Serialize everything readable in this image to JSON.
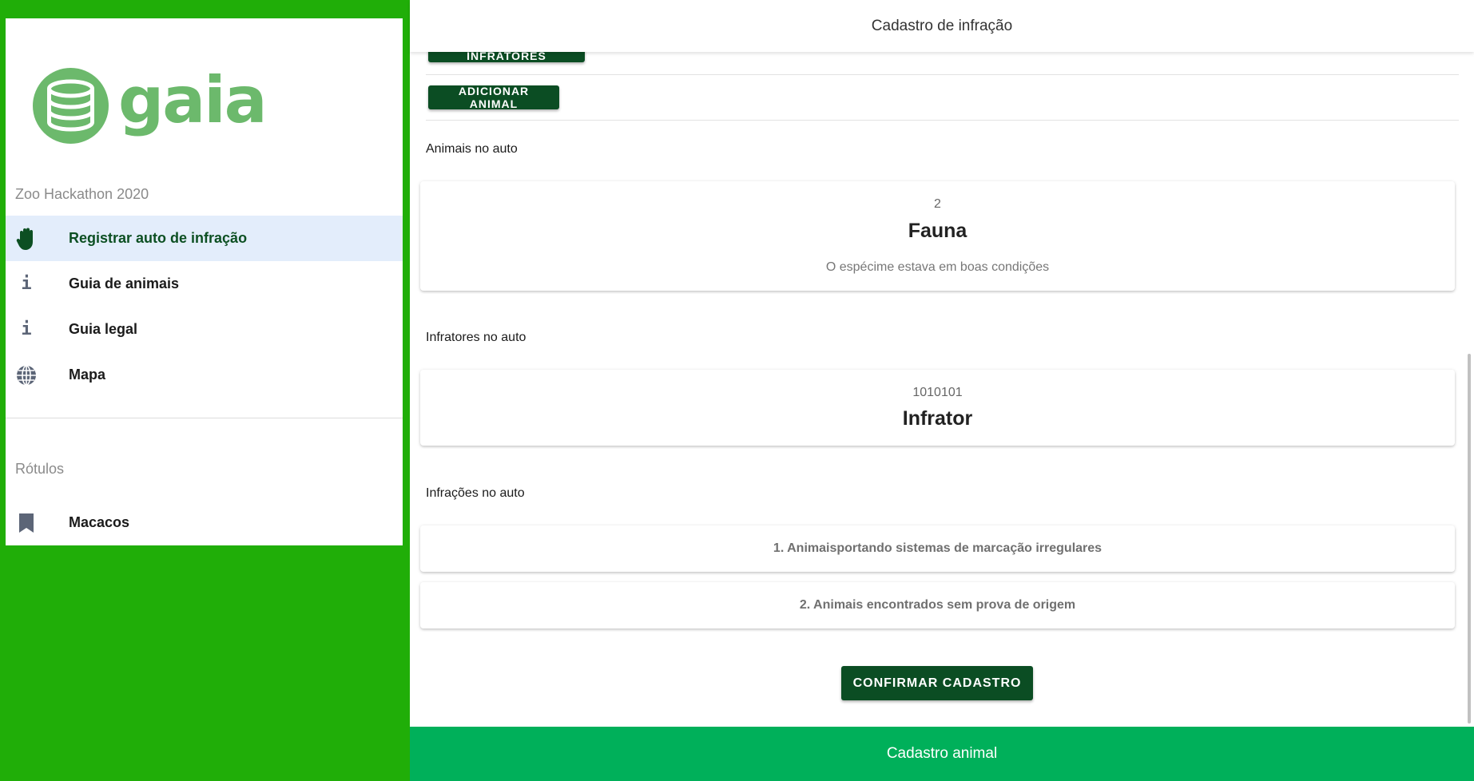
{
  "app": {
    "logo_text": "gaia",
    "subtitle": "Zoo Hackathon 2020",
    "brand_color": "#6cb96c",
    "accent_color": "#0b4d23"
  },
  "sidebar": {
    "items": [
      {
        "label": "Registrar auto de infração",
        "icon": "hand-icon",
        "active": true
      },
      {
        "label": "Guia de animais",
        "icon": "info-icon"
      },
      {
        "label": "Guia legal",
        "icon": "info-icon"
      },
      {
        "label": "Mapa",
        "icon": "globe-icon"
      }
    ],
    "section_title": "Rótulos",
    "labels": [
      {
        "label": "Macacos",
        "icon": "bookmark-icon"
      }
    ]
  },
  "header": {
    "title": "Cadastro de infração"
  },
  "main": {
    "add_infratores_label": "ADICIONAR INFRATORES",
    "add_animal_label": "ADICIONAR ANIMAL",
    "animals_section": "Animais no auto",
    "animal_card": {
      "count": "2",
      "name": "Fauna",
      "description": "O espécime estava em boas condições"
    },
    "infratores_section": "Infratores no auto",
    "infrator_card": {
      "id": "1010101",
      "name": "Infrator"
    },
    "infracoes_section": "Infrações no auto",
    "infracoes": [
      "1. Animaisportando sistemas de marcação irregulares",
      "2. Animais encontrados sem prova de origem"
    ],
    "confirm_label": "CONFIRMAR CADASTRO"
  },
  "footer": {
    "label": "Cadastro animal",
    "color": "#00b05a"
  }
}
